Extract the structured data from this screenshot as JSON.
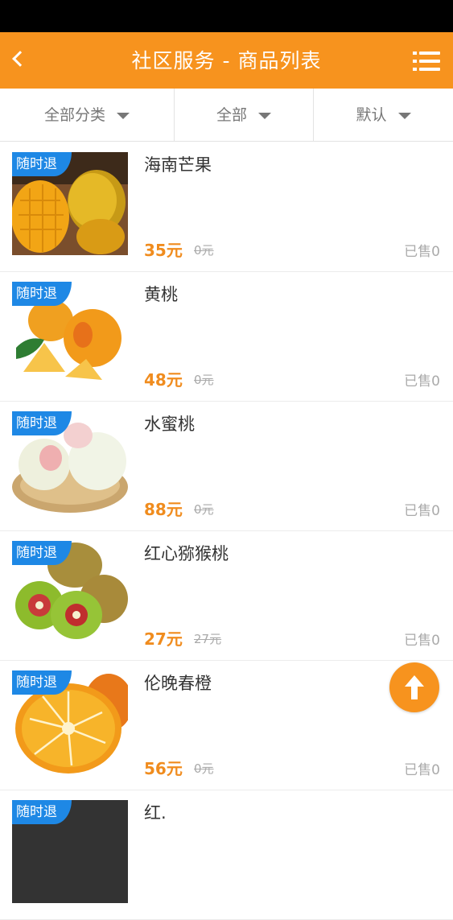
{
  "header": {
    "title": "社区服务 - 商品列表",
    "back_icon": "chevron-left-icon",
    "menu_icon": "list-menu-icon"
  },
  "filters": [
    {
      "label": "全部分类"
    },
    {
      "label": "全部"
    },
    {
      "label": "默认"
    }
  ],
  "products": [
    {
      "badge": "随时退",
      "name": "海南芒果",
      "price": "35元",
      "original_price": "0元",
      "sold": "已售0"
    },
    {
      "badge": "随时退",
      "name": "黄桃",
      "price": "48元",
      "original_price": "0元",
      "sold": "已售0"
    },
    {
      "badge": "随时退",
      "name": "水蜜桃",
      "price": "88元",
      "original_price": "0元",
      "sold": "已售0"
    },
    {
      "badge": "随时退",
      "name": "红心猕猴桃",
      "price": "27元",
      "original_price": "27元",
      "sold": "已售0"
    },
    {
      "badge": "随时退",
      "name": "伦晚春橙",
      "price": "56元",
      "original_price": "0元",
      "sold": "已售0"
    },
    {
      "badge": "随时退",
      "name": "红.",
      "price": "",
      "original_price": "",
      "sold": ""
    }
  ],
  "fab_icon": "arrow-up-icon",
  "colors": {
    "header": "#f7931e",
    "price": "#f08c1e",
    "badge": "#1e88e5"
  }
}
